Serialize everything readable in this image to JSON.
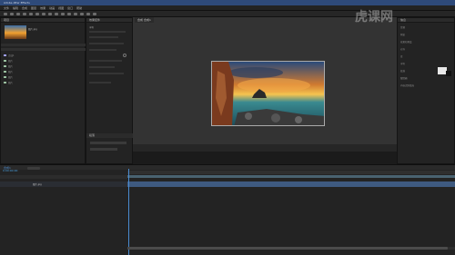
{
  "app": {
    "title": "Adobe After Effects"
  },
  "menu": [
    "文件",
    "编辑",
    "合成",
    "图层",
    "效果",
    "动画",
    "视图",
    "窗口",
    "帮助"
  ],
  "project_panel": {
    "title": "项目",
    "thumb_label": "图片.jpg",
    "items": [
      {
        "name": "合成1",
        "color": "#a0a0ff"
      },
      {
        "name": "图片",
        "color": "#9ac0a0"
      },
      {
        "name": "图片",
        "color": "#9ac0a0"
      },
      {
        "name": "图片",
        "color": "#9ac0a0"
      },
      {
        "name": "图片",
        "color": "#9ac0a0"
      },
      {
        "name": "图片",
        "color": "#9ac0a0"
      }
    ]
  },
  "effects_panel": {
    "title": "效果控件",
    "sub_title": "字符",
    "bottom_title": "段落"
  },
  "viewer": {
    "tab_label": "合成 合成1"
  },
  "right_panel": {
    "header": "信息",
    "sections": [
      "音频",
      "预览",
      "效果和预设",
      "对齐",
      "库",
      "字符",
      "段落",
      "跟踪器",
      "内容识别填充"
    ]
  },
  "timeline": {
    "tab_label": "合成1",
    "timecode": "0:00:00:00",
    "layer_name": "图片.jpg"
  },
  "watermark": {
    "text": "虎课网"
  },
  "colors": {
    "accent": "#4a8bd0",
    "timeline_bar": "#3e5a80"
  }
}
